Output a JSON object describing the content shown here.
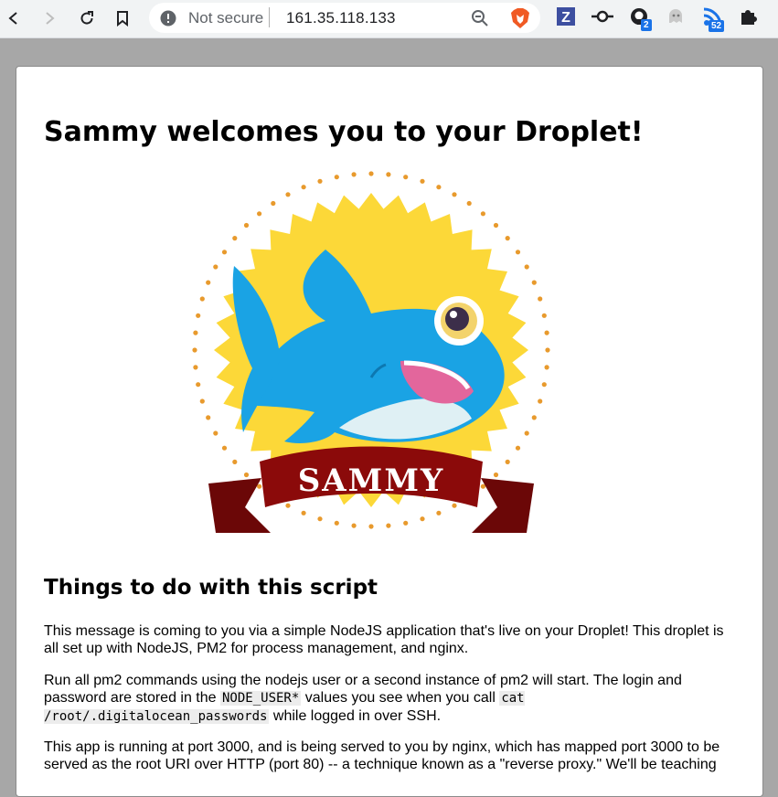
{
  "browser": {
    "security_label": "Not secure",
    "url": "161.35.118.133",
    "extensions": [
      {
        "name": "zotero-icon",
        "glyph": "Z"
      },
      {
        "name": "commit-icon"
      },
      {
        "name": "github-icon",
        "badge": "2"
      },
      {
        "name": "ghost-icon"
      },
      {
        "name": "feed-icon",
        "badge": "52"
      },
      {
        "name": "puzzle-icon"
      }
    ]
  },
  "page": {
    "title": "Sammy welcomes you to your Droplet!",
    "logo_text": "SAMMY",
    "section_heading": "Things to do with this script",
    "paragraph1": "This message is coming to you via a simple NodeJS application that's live on your Droplet! This droplet is all set up with NodeJS, PM2 for process management, and nginx.",
    "paragraph2_part1": "Run all pm2 commands using the nodejs user or a second instance of pm2 will start. The login and password are stored in the ",
    "paragraph2_code1": "NODE_USER*",
    "paragraph2_part2": " values you see when you call ",
    "paragraph2_code2": "cat /root/.digitalocean_passwords",
    "paragraph2_part3": " while logged in over SSH.",
    "paragraph3": "This app is running at port 3000, and is being served to you by nginx, which has mapped port 3000 to be served as the root URI over HTTP (port 80) -- a technique known as a \"reverse proxy.\" We'll be teaching"
  },
  "colors": {
    "sun": "#fcd838",
    "dots": "#e89a2d",
    "shark": "#1aa3e4",
    "banner": "#8b0a0a",
    "badge": "#1a73e8"
  }
}
